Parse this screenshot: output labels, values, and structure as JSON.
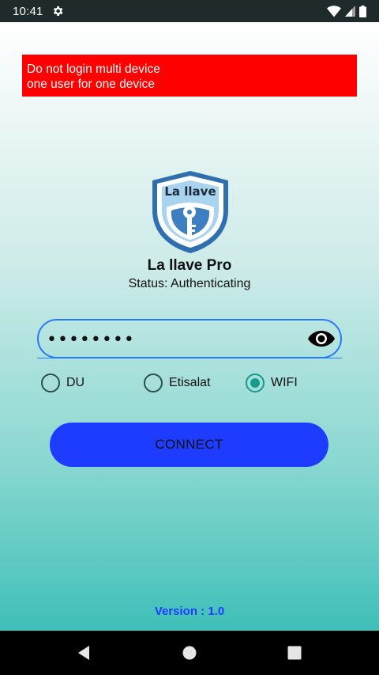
{
  "status_bar": {
    "time": "10:41",
    "icons": [
      "gear-icon",
      "wifi-icon",
      "signal-icon",
      "battery-icon"
    ]
  },
  "warning": {
    "line1": "Do not login multi device",
    "line2": "one user for one device",
    "background": "#ff0000"
  },
  "logo": {
    "text": "La llave"
  },
  "app": {
    "title": "La llave Pro",
    "status": "Status: Authenticating"
  },
  "password": {
    "value": "••••••••",
    "visibility_icon": "eye-icon"
  },
  "network_options": [
    {
      "label": "DU",
      "selected": false
    },
    {
      "label": "Etisalat",
      "selected": false
    },
    {
      "label": "WIFI",
      "selected": true
    }
  ],
  "connect_label": "CONNECT",
  "version": "Version : 1.0",
  "colors": {
    "accent": "#1e3cff",
    "field_border": "#2979ff",
    "radio_selected": "#17998f"
  },
  "nav_bar": {
    "icons": [
      "back-icon",
      "home-icon",
      "recents-icon"
    ]
  }
}
